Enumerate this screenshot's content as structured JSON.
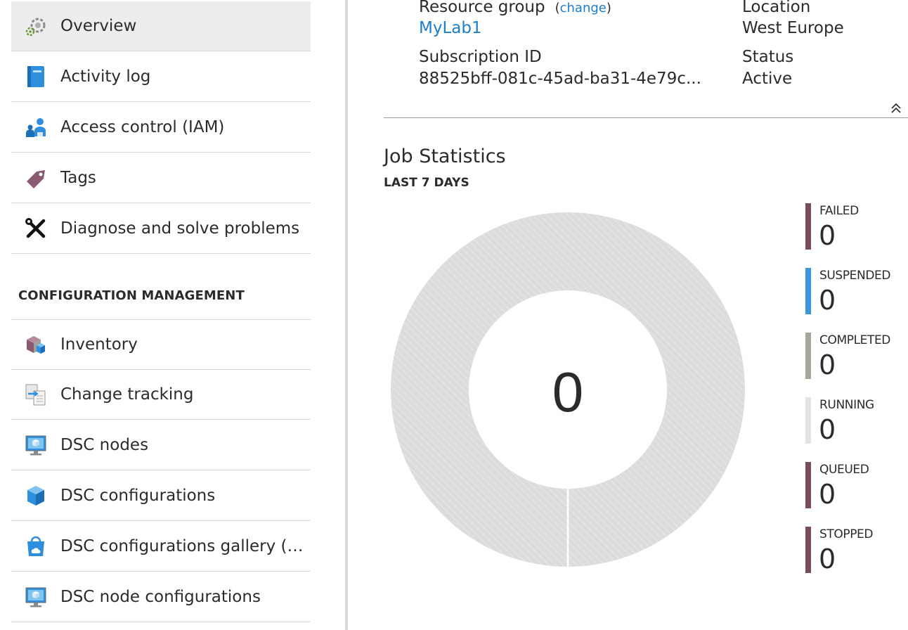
{
  "sidebar": {
    "items": [
      {
        "label": "Overview",
        "icon": "overview-icon",
        "selected": true
      },
      {
        "label": "Activity log",
        "icon": "activity-log-icon"
      },
      {
        "label": "Access control (IAM)",
        "icon": "access-control-icon"
      },
      {
        "label": "Tags",
        "icon": "tag-icon"
      },
      {
        "label": "Diagnose and solve problems",
        "icon": "wrench-icon"
      }
    ],
    "section_heading": "CONFIGURATION MANAGEMENT",
    "config_items": [
      {
        "label": "Inventory",
        "icon": "inventory-icon"
      },
      {
        "label": "Change tracking",
        "icon": "change-tracking-icon"
      },
      {
        "label": "DSC nodes",
        "icon": "dsc-nodes-icon"
      },
      {
        "label": "DSC configurations",
        "icon": "dsc-configurations-icon"
      },
      {
        "label": "DSC configurations gallery (Pre...",
        "icon": "dsc-gallery-icon"
      },
      {
        "label": "DSC node configurations",
        "icon": "dsc-node-configurations-icon"
      }
    ]
  },
  "essentials": {
    "resource_group_label": "Resource group",
    "change_link": "change",
    "resource_group_value": "MyLab1",
    "location_label": "Location",
    "location_value": "West Europe",
    "subscription_label": "Subscription ID",
    "subscription_value": "88525bff-081c-45ad-ba31-4e79c...",
    "status_label": "Status",
    "status_value": "Active",
    "collapse_icon": "double-chevron-up-icon"
  },
  "job_stats": {
    "title": "Job Statistics",
    "subtitle": "LAST 7 DAYS",
    "total": "0",
    "legend": [
      {
        "name": "FAILED",
        "value": "0",
        "color": "#7a4a5e"
      },
      {
        "name": "SUSPENDED",
        "value": "0",
        "color": "#3a96dd"
      },
      {
        "name": "COMPLETED",
        "value": "0",
        "color": "#a5a898"
      },
      {
        "name": "RUNNING",
        "value": "0",
        "color": "#e3e3e3"
      },
      {
        "name": "QUEUED",
        "value": "0",
        "color": "#7a4a5e"
      },
      {
        "name": "STOPPED",
        "value": "0",
        "color": "#7a4a5e"
      }
    ]
  },
  "colors": {
    "link": "#1e7ec8",
    "donut_fill": "#dcdcdc",
    "selected_bg": "#ededed"
  }
}
